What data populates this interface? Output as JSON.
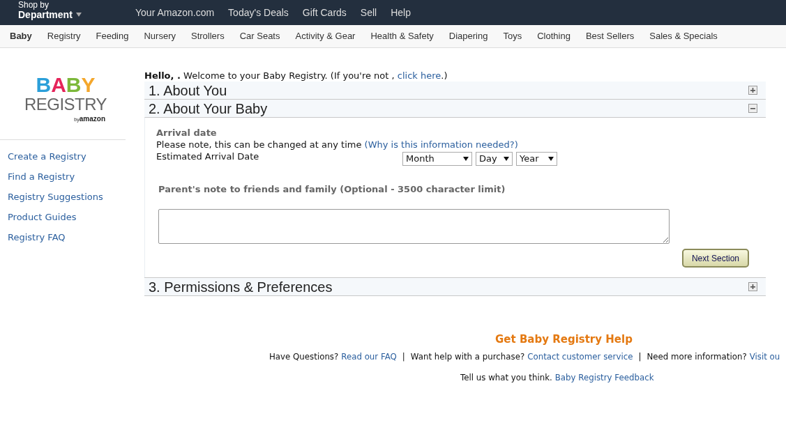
{
  "top_bar": {
    "shop_by": "Shop by",
    "department": "Department",
    "links": [
      "Your Amazon.com",
      "Today's Deals",
      "Gift Cards",
      "Sell",
      "Help"
    ]
  },
  "category_nav": [
    {
      "label": "Baby",
      "selected": true
    },
    {
      "label": "Registry",
      "selected": false
    },
    {
      "label": "Feeding",
      "selected": false
    },
    {
      "label": "Nursery",
      "selected": false
    },
    {
      "label": "Strollers",
      "selected": false
    },
    {
      "label": "Car Seats",
      "selected": false
    },
    {
      "label": "Activity & Gear",
      "selected": false
    },
    {
      "label": "Health & Safety",
      "selected": false
    },
    {
      "label": "Diapering",
      "selected": false
    },
    {
      "label": "Toys",
      "selected": false
    },
    {
      "label": "Clothing",
      "selected": false
    },
    {
      "label": "Best Sellers",
      "selected": false
    },
    {
      "label": "Sales & Specials",
      "selected": false
    }
  ],
  "logo": {
    "top": "BABY",
    "bottom": "REGISTRY",
    "by": "by",
    "brand": "amazon"
  },
  "sidebar_links": [
    "Create a Registry",
    "Find a Registry",
    "Registry Suggestions",
    "Product Guides",
    "Registry FAQ"
  ],
  "greeting": {
    "hello": "Hello, .",
    "text": "Welcome to your Baby Registry. (If you're not ,",
    "link": "click here",
    "end": ".)"
  },
  "sections": [
    {
      "title": "1. About You",
      "expanded": false
    },
    {
      "title": "2. About Your Baby",
      "expanded": true
    },
    {
      "title": "3. Permissions & Preferences",
      "expanded": false
    }
  ],
  "about_baby": {
    "heading": "Arrival date",
    "note": "Please note, this can be changed at any time",
    "note_link": "(Why is this information needed?)",
    "date_label": "Estimated Arrival Date",
    "selects": [
      "Month",
      "Day",
      "Year"
    ],
    "message_label": "Parent's note to friends and family (Optional - 3500 character limit)",
    "next_button": "Next Section"
  },
  "help": {
    "title": "Get Baby Registry Help",
    "separator": "|",
    "line": [
      {
        "text": "Have Questions?",
        "link": "Read our FAQ"
      },
      {
        "text": "Want help with a purchase?",
        "link": "Contact customer service"
      },
      {
        "text": "Need more information?",
        "link": "Visit ou"
      }
    ],
    "feedback_text": "Tell us what you think.",
    "feedback_link": "Baby Registry Feedback"
  }
}
